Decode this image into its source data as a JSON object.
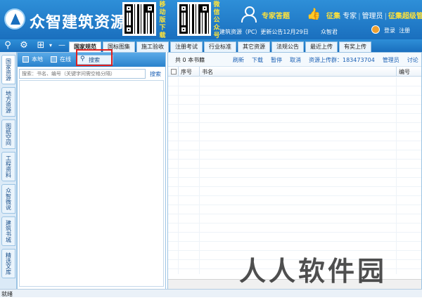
{
  "header": {
    "brand": "众智建筑资源",
    "qr_left_label": [
      "移",
      "动",
      "版",
      "下",
      "载"
    ],
    "qr_right_label": [
      "微",
      "信",
      "公",
      "众",
      "号"
    ],
    "expert_label": "专家答题",
    "links": {
      "collect": "征集",
      "expert": "专家",
      "admin": "管理员",
      "collect_admin": "征集超级管理员"
    },
    "notice": "建筑资源（PC）更新公告12月29日",
    "notice_user": "众智君",
    "login": "登录",
    "register": "注册"
  },
  "toolbar": {
    "search_icon": "search-icon",
    "settings_icon": "gear-icon",
    "add_icon": "add-icon"
  },
  "top_tabs": [
    {
      "label": "国家规范",
      "active": true
    },
    {
      "label": "国标图集",
      "active": false
    },
    {
      "label": "施工验收",
      "active": false
    },
    {
      "label": "注册考试",
      "active": false
    },
    {
      "label": "行业标准",
      "active": false
    },
    {
      "label": "其它资源",
      "active": false
    },
    {
      "label": "法规公告",
      "active": false
    },
    {
      "label": "最近上传",
      "active": false
    },
    {
      "label": "有奖上传",
      "active": false
    }
  ],
  "side_tabs": [
    {
      "label": "国家资源",
      "active": true
    },
    {
      "label": "地方资源",
      "active": false
    },
    {
      "label": "图纸空间",
      "active": false
    },
    {
      "label": "工程资料",
      "active": false
    },
    {
      "label": "众智微说",
      "active": false
    },
    {
      "label": "建筑书城",
      "active": false
    },
    {
      "label": "精选文库",
      "active": false
    }
  ],
  "left_panel": {
    "local_label": "本地",
    "online_label": "在线",
    "search_label": "搜索",
    "search_placeholder": "搜索：书名、编号（关键字间需空格分隔）",
    "search_link": "搜索"
  },
  "right_panel": {
    "count_text": "共 0 本书籍",
    "actions": {
      "refresh": "刷新",
      "download": "下载",
      "pause": "暂停",
      "cancel": "取消",
      "uploader_label": "资源上传群：",
      "uploader_num": "183473704",
      "admin": "管理员",
      "discuss": "讨论"
    },
    "columns": {
      "index": "序号",
      "name": "书名",
      "code": "编号"
    }
  },
  "status": {
    "text": "就绪"
  },
  "watermark": "人人软件园"
}
